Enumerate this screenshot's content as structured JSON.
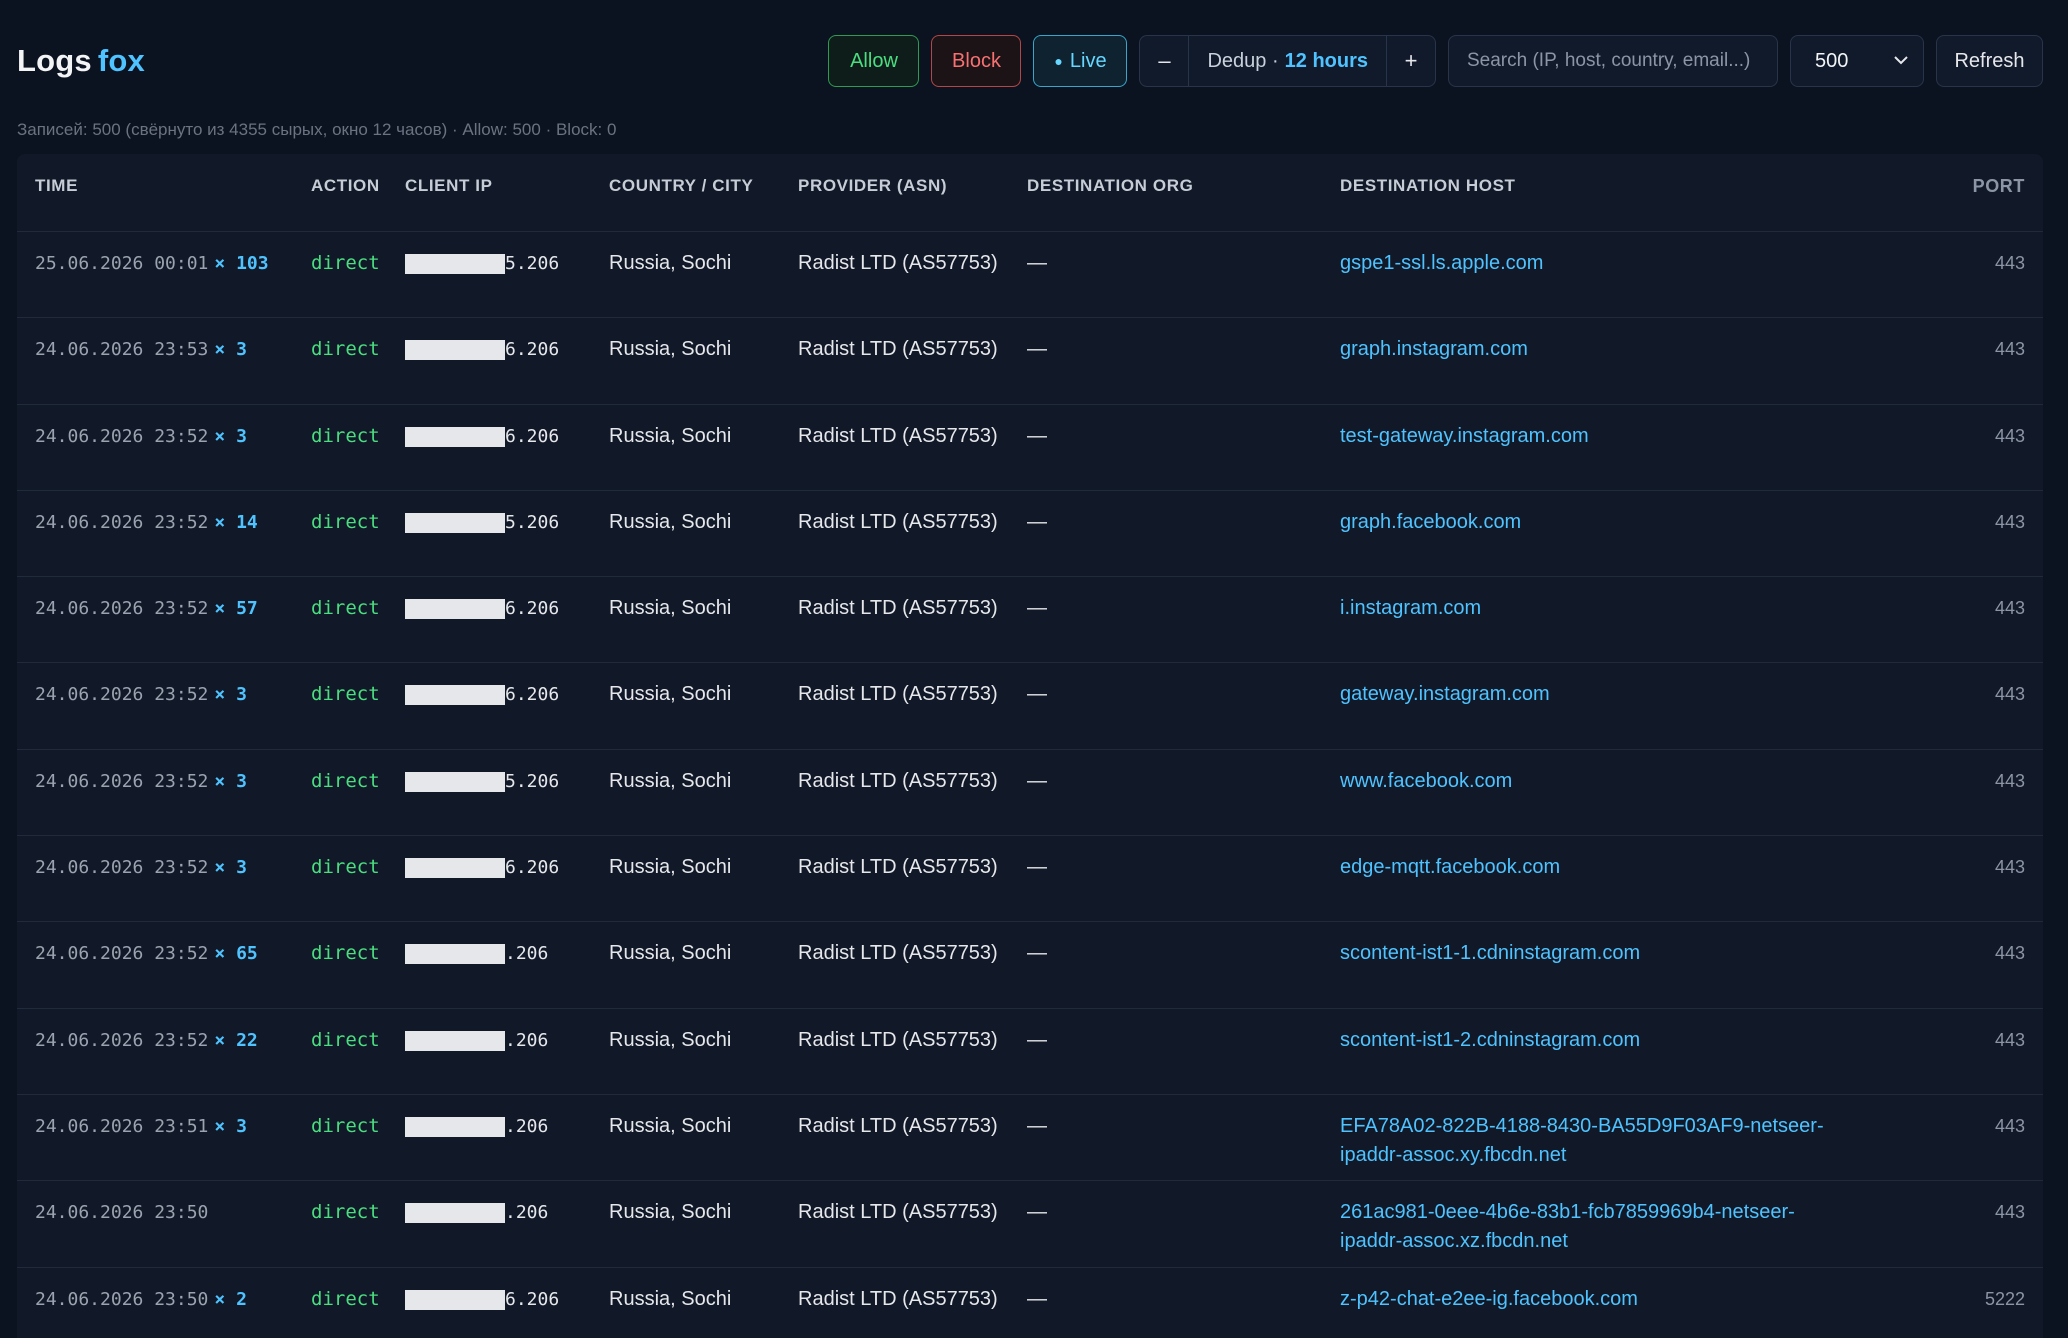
{
  "header": {
    "title": "Logs",
    "title_accent": "fox"
  },
  "controls": {
    "allow": "Allow",
    "block": "Block",
    "live_dot": "●",
    "live": "Live",
    "dedup_minus": "–",
    "dedup_label": "Dedup ·",
    "dedup_value": "12 hours",
    "dedup_plus": "+",
    "search_placeholder": "Search (IP, host, country, email...)",
    "limit_value": "500",
    "refresh": "Refresh"
  },
  "summary": "Записей: 500 (свёрнуто из 4355 сырых, окно 12 часов) · Allow: 500 · Block: 0",
  "columns": [
    "TIME",
    "ACTION",
    "CLIENT IP",
    "COUNTRY / CITY",
    "PROVIDER (ASN)",
    "DESTINATION ORG",
    "DESTINATION HOST",
    "PORT"
  ],
  "rows": [
    {
      "time": "25.06.2026 00:01",
      "count": "× 103",
      "action": "direct",
      "ip_suffix": "5.206",
      "country": "Russia, Sochi",
      "provider": "Radist LTD (AS57753)",
      "org": "—",
      "host": "gspe1-ssl.ls.apple.com",
      "port": "443"
    },
    {
      "time": "24.06.2026 23:53",
      "count": "× 3",
      "action": "direct",
      "ip_suffix": "6.206",
      "country": "Russia, Sochi",
      "provider": "Radist LTD (AS57753)",
      "org": "—",
      "host": "graph.instagram.com",
      "port": "443"
    },
    {
      "time": "24.06.2026 23:52",
      "count": "× 3",
      "action": "direct",
      "ip_suffix": "6.206",
      "country": "Russia, Sochi",
      "provider": "Radist LTD (AS57753)",
      "org": "—",
      "host": "test-gateway.instagram.com",
      "port": "443"
    },
    {
      "time": "24.06.2026 23:52",
      "count": "× 14",
      "action": "direct",
      "ip_suffix": "5.206",
      "country": "Russia, Sochi",
      "provider": "Radist LTD (AS57753)",
      "org": "—",
      "host": "graph.facebook.com",
      "port": "443"
    },
    {
      "time": "24.06.2026 23:52",
      "count": "× 57",
      "action": "direct",
      "ip_suffix": "6.206",
      "country": "Russia, Sochi",
      "provider": "Radist LTD (AS57753)",
      "org": "—",
      "host": "i.instagram.com",
      "port": "443"
    },
    {
      "time": "24.06.2026 23:52",
      "count": "× 3",
      "action": "direct",
      "ip_suffix": "6.206",
      "country": "Russia, Sochi",
      "provider": "Radist LTD (AS57753)",
      "org": "—",
      "host": "gateway.instagram.com",
      "port": "443"
    },
    {
      "time": "24.06.2026 23:52",
      "count": "× 3",
      "action": "direct",
      "ip_suffix": "5.206",
      "country": "Russia, Sochi",
      "provider": "Radist LTD (AS57753)",
      "org": "—",
      "host": "www.facebook.com",
      "port": "443"
    },
    {
      "time": "24.06.2026 23:52",
      "count": "× 3",
      "action": "direct",
      "ip_suffix": "6.206",
      "country": "Russia, Sochi",
      "provider": "Radist LTD (AS57753)",
      "org": "—",
      "host": "edge-mqtt.facebook.com",
      "port": "443"
    },
    {
      "time": "24.06.2026 23:52",
      "count": "× 65",
      "action": "direct",
      "ip_suffix": ".206",
      "country": "Russia, Sochi",
      "provider": "Radist LTD (AS57753)",
      "org": "—",
      "host": "scontent-ist1-1.cdninstagram.com",
      "port": "443"
    },
    {
      "time": "24.06.2026 23:52",
      "count": "× 22",
      "action": "direct",
      "ip_suffix": ".206",
      "country": "Russia, Sochi",
      "provider": "Radist LTD (AS57753)",
      "org": "—",
      "host": "scontent-ist1-2.cdninstagram.com",
      "port": "443"
    },
    {
      "time": "24.06.2026 23:51",
      "count": "× 3",
      "action": "direct",
      "ip_suffix": ".206",
      "country": "Russia, Sochi",
      "provider": "Radist LTD (AS57753)",
      "org": "—",
      "host": "EFA78A02-822B-4188-8430-BA55D9F03AF9-netseer-ipaddr-assoc.xy.fbcdn.net",
      "port": "443"
    },
    {
      "time": "24.06.2026 23:50",
      "count": "",
      "action": "direct",
      "ip_suffix": ".206",
      "country": "Russia, Sochi",
      "provider": "Radist LTD (AS57753)",
      "org": "—",
      "host": "261ac981-0eee-4b6e-83b1-fcb7859969b4-netseer-ipaddr-assoc.xz.fbcdn.net",
      "port": "443"
    },
    {
      "time": "24.06.2026 23:50",
      "count": "× 2",
      "action": "direct",
      "ip_suffix": "6.206",
      "country": "Russia, Sochi",
      "provider": "Radist LTD (AS57753)",
      "org": "—",
      "host": "z-p42-chat-e2ee-ig.facebook.com",
      "port": "5222"
    }
  ]
}
